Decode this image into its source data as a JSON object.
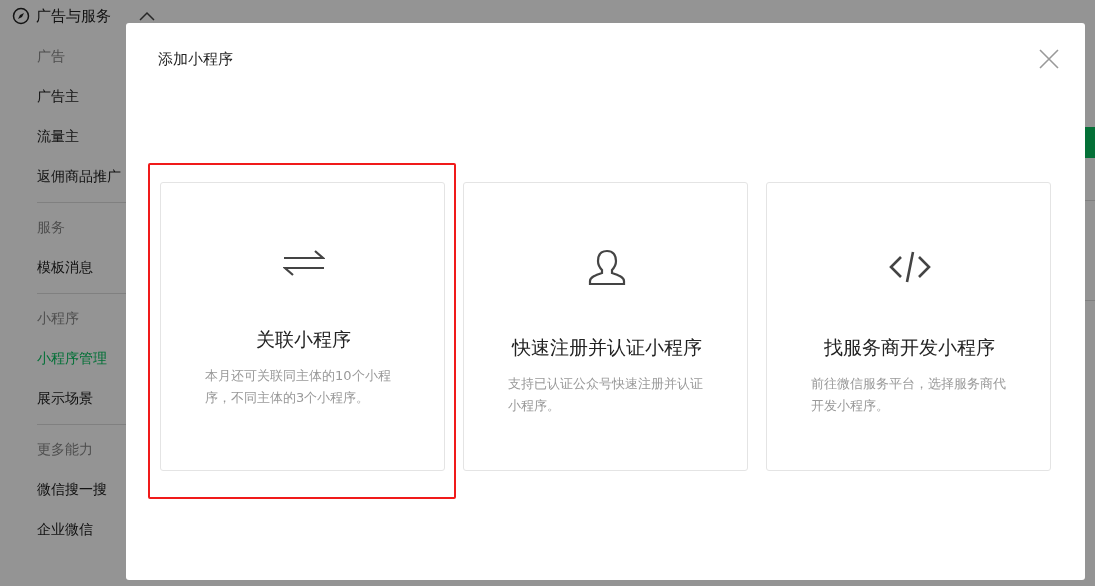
{
  "sidebar": {
    "header": {
      "label": "广告与服务",
      "expanded": true
    },
    "sections": [
      {
        "title": "广告",
        "items": [
          {
            "label": "广告主",
            "selected": false
          },
          {
            "label": "流量主",
            "selected": false
          },
          {
            "label": "返佣商品推广",
            "selected": false
          }
        ]
      },
      {
        "title": "服务",
        "items": [
          {
            "label": "模板消息",
            "selected": false
          }
        ]
      },
      {
        "title": "小程序",
        "items": [
          {
            "label": "小程序管理",
            "selected": true
          },
          {
            "label": "展示场景",
            "selected": false
          }
        ]
      },
      {
        "title": "更多能力",
        "items": [
          {
            "label": "微信搜一搜",
            "selected": false
          },
          {
            "label": "企业微信",
            "selected": false
          }
        ]
      }
    ]
  },
  "dialog": {
    "title": "添加小程序",
    "options": [
      {
        "kind": "swap",
        "title": "关联小程序",
        "description": "本月还可关联同主体的10个小程序，不同主体的3个小程序。",
        "highlighted": true
      },
      {
        "kind": "user",
        "title": "快速注册并认证小程序",
        "description": "支持已认证公众号快速注册并认证小程序。",
        "highlighted": false
      },
      {
        "kind": "code",
        "title": "找服务商开发小程序",
        "description": "前往微信服务平台，选择服务商代开发小程序。",
        "highlighted": false
      }
    ]
  }
}
